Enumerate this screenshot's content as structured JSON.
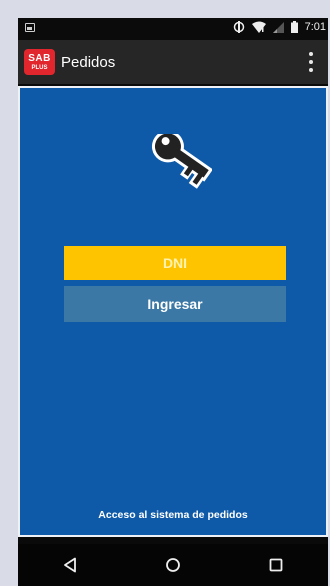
{
  "status_bar": {
    "time": "7:01"
  },
  "app_bar": {
    "logo_line1": "SAB",
    "logo_line2": "PLUS",
    "title": "Pedidos"
  },
  "login": {
    "dni_placeholder": "DNI",
    "submit_label": "Ingresar",
    "footer": "Acceso al sistema de pedidos"
  },
  "colors": {
    "background": "#0e5aa8",
    "dni_field": "#ffc400",
    "submit_button": "#3c78a6",
    "logo": "#e1262d"
  },
  "icons": [
    "notification-icon",
    "data-icon",
    "wifi-icon",
    "signal-icon",
    "battery-icon",
    "overflow-menu-icon",
    "key-icon",
    "back-icon",
    "home-icon",
    "recents-icon"
  ]
}
